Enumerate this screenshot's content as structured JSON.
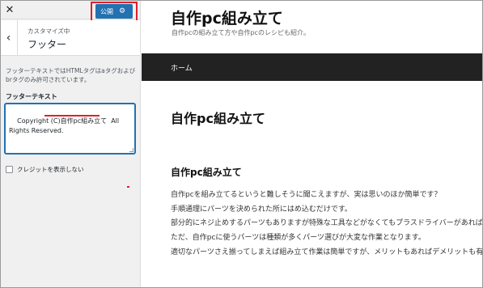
{
  "customizer": {
    "close_glyph": "✕",
    "publish_label": "公開",
    "publish_icon": "gear-icon",
    "back_glyph": "‹",
    "customizing_label": "カスタマイズ中",
    "section_title": "フッター",
    "description": "フッターテキストではHTMLタグはaタグおよびbrタグのみ許可されています。",
    "field_label": "フッターテキスト",
    "footer_text_value": "Copyright (C)自作pc組み立て  All Rights Reserved.",
    "checkbox_label": "クレジットを表示しない",
    "checkbox_checked": false,
    "accent_color": "#2271b1",
    "annotation_color": "#e0202a"
  },
  "preview": {
    "site_title": "自作pc組み立て",
    "site_tagline": "自作pcの組み立て方や自作pcのレシピも紹介。",
    "nav": {
      "home_label": "ホーム"
    },
    "post_title": "自作pc組み立て",
    "heading": "自作pc組み立て",
    "paragraph_lines": [
      "自作pcを組み立てるというと難しそうに聞こえますが、実は思いのほか簡単です？",
      "手順通理にパーツを決められた所にはめ込むだけです。",
      "部分的にネジ止めするパーツもありますが特殊な工具などがなくてもプラスドライバーがあれば充分です。",
      "ただ、自作pcに使うパーツは種類が多くパーツ選びが大変な作業となります。",
      "適切なパーツさえ揃ってしまえば組み立て作業は簡単ですが、メリットもあればデメリットも有ります。"
    ],
    "nav_bar_color": "#222222"
  }
}
